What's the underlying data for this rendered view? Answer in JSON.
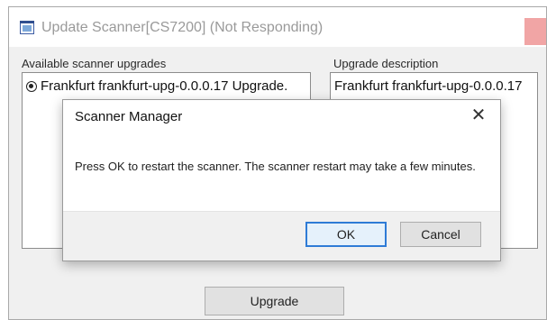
{
  "main_window": {
    "title": "Update Scanner[CS7200] (Not Responding)",
    "available_label": "Available scanner upgrades",
    "description_label": "Upgrade description",
    "upgrades": [
      {
        "label": "Frankfurt frankfurt-upg-0.0.0.17 Upgrade.",
        "selected": true
      }
    ],
    "description_text": "Frankfurt frankfurt-upg-0.0.0.17",
    "upgrade_button": "Upgrade"
  },
  "dialog": {
    "title": "Scanner Manager",
    "close_glyph": "✕",
    "message": "Press OK to restart the scanner. The scanner restart may take a few minutes.",
    "ok_label": "OK",
    "cancel_label": "Cancel"
  },
  "colors": {
    "accent": "#2e7bd6",
    "not_responding_close": "#f1a5a5"
  }
}
